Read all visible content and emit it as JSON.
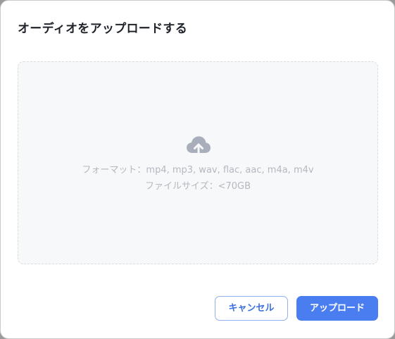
{
  "dialog": {
    "title": "オーディオをアップロードする"
  },
  "dropzone": {
    "icon": "cloud-upload-icon",
    "formats_hint": "フォーマット：mp4, mp3, wav, flac, aac, m4a, m4v",
    "size_hint": "ファイルサイズ：<70GB"
  },
  "actions": {
    "cancel_label": "キャンセル",
    "upload_label": "アップロード"
  },
  "colors": {
    "primary": "#4a7ef0",
    "primary_border_light": "#8fb1ef",
    "dropzone_bg": "#f7f8fa",
    "hint_text": "#b4b8bf",
    "icon": "#a9afba"
  }
}
